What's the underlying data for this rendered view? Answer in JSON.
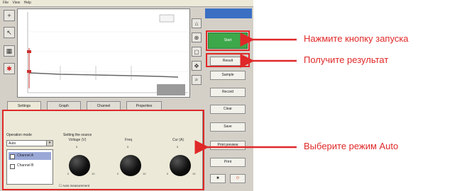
{
  "menubar": {
    "items": [
      "File",
      "View",
      "Help"
    ]
  },
  "plot": {
    "title": ""
  },
  "tabs": [
    {
      "label": "Settings"
    },
    {
      "label": "Graph"
    },
    {
      "label": "Channel"
    },
    {
      "label": "Properties"
    }
  ],
  "panel": {
    "mode_group_title": "Operation mode",
    "mode_value": "Auto",
    "list_items": [
      "Channel A",
      "Channel B"
    ],
    "knobs_title": "Setting the source",
    "knobs": [
      {
        "label": "Voltage (V)",
        "scale": [
          "0",
          "5",
          "10"
        ]
      },
      {
        "label": "Freq",
        "scale": [
          "0",
          "5",
          "10"
        ]
      },
      {
        "label": "Cur (A)",
        "scale": [
          "0",
          "5",
          "10"
        ]
      }
    ],
    "footer_check": "Auto measurement"
  },
  "sidebar": {
    "start_label": "Start",
    "buttons": [
      "Result",
      "Sample",
      "Record",
      "Clear",
      "Save",
      "Print preview",
      "Print"
    ]
  },
  "callouts": {
    "start": "Нажмите кнопку запуска",
    "result": "Получите результат",
    "mode": "Выберите режим Auto"
  },
  "colors": {
    "accent": "#e02828",
    "start_button": "#3da84a",
    "sidebar_header": "#3a6fc4"
  }
}
